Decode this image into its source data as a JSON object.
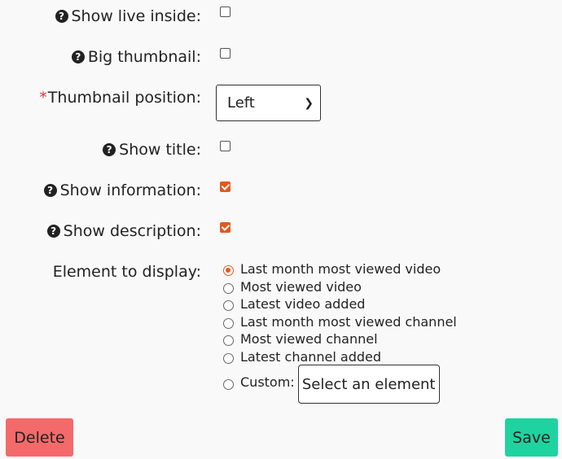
{
  "fields": {
    "show_live_inside": {
      "label": "Show live inside:",
      "help": "?",
      "checked": false
    },
    "big_thumbnail": {
      "label": "Big thumbnail:",
      "help": "?",
      "checked": false
    },
    "thumbnail_position": {
      "required_mark": "*",
      "label": "Thumbnail position:",
      "value": "Left"
    },
    "show_title": {
      "label": "Show title:",
      "help": "?",
      "checked": false
    },
    "show_information": {
      "label": "Show information:",
      "help": "?",
      "checked": true
    },
    "show_description": {
      "label": "Show description:",
      "help": "?",
      "checked": true
    }
  },
  "element_to_display": {
    "label": "Element to display:",
    "options": [
      {
        "label": "Last month most viewed video",
        "checked": true
      },
      {
        "label": "Most viewed video",
        "checked": false
      },
      {
        "label": "Latest video added",
        "checked": false
      },
      {
        "label": "Last month most viewed channel",
        "checked": false
      },
      {
        "label": "Most viewed channel",
        "checked": false
      },
      {
        "label": "Latest channel added",
        "checked": false
      }
    ],
    "custom_label": "Custom:",
    "custom_button": "Select an element"
  },
  "buttons": {
    "delete": "Delete",
    "save": "Save"
  },
  "colors": {
    "accent": "#e05a1d",
    "delete_bg": "#f46a6a",
    "save_bg": "#1fd3a0",
    "required": "#d83a2e"
  }
}
